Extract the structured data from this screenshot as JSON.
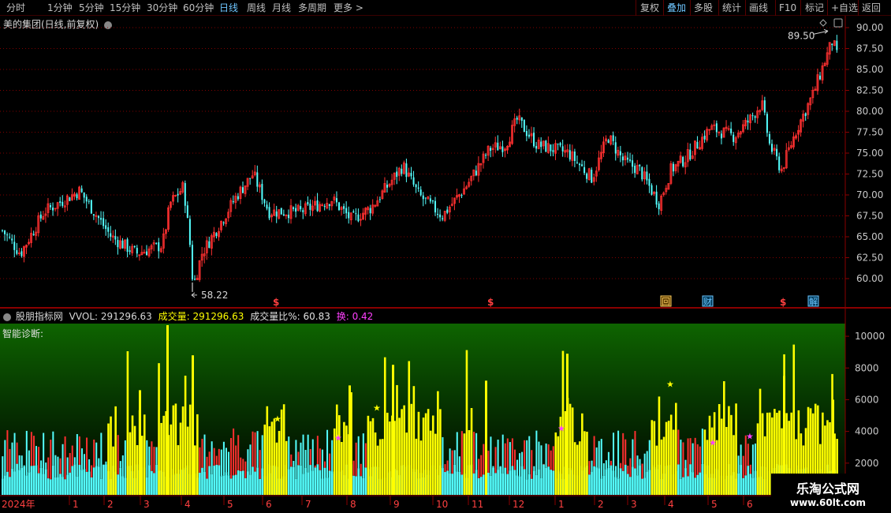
{
  "toolbar": {
    "left_items": [
      {
        "label": "分时",
        "active": false
      },
      {
        "label": "1分钟",
        "active": false
      },
      {
        "label": "5分钟",
        "active": false
      },
      {
        "label": "15分钟",
        "active": false
      },
      {
        "label": "30分钟",
        "active": false
      },
      {
        "label": "60分钟",
        "active": false
      },
      {
        "label": "日线",
        "active": true
      },
      {
        "label": "周线",
        "active": false
      },
      {
        "label": "月线",
        "active": false
      },
      {
        "label": "多周期",
        "active": false
      },
      {
        "label": "更多 >",
        "active": false
      }
    ],
    "right_items": [
      {
        "label": "复权",
        "active": false
      },
      {
        "label": "叠加",
        "active": true
      },
      {
        "label": "多股",
        "active": false
      },
      {
        "label": "统计",
        "active": false
      },
      {
        "label": "画线",
        "active": false
      },
      {
        "label": "F10",
        "active": false
      },
      {
        "label": "标记",
        "active": false
      },
      {
        "label": "+自选",
        "active": false
      },
      {
        "label": "返回",
        "active": false
      }
    ]
  },
  "main": {
    "stock_title": "美的集团(日线,前复权)",
    "price_axis": [
      "90.00",
      "87.50",
      "85.00",
      "82.50",
      "80.00",
      "77.50",
      "75.00",
      "72.50",
      "70.00",
      "67.50",
      "65.00",
      "62.50",
      "60.00"
    ],
    "high_label": "89.50",
    "low_label": "58.22",
    "markers": [
      {
        "label": "$",
        "color": "#ff4040"
      },
      {
        "label": "$",
        "color": "#ff4040"
      },
      {
        "label": "回",
        "color": "#ffd060"
      },
      {
        "label": "财",
        "color": "#6ec6ff"
      },
      {
        "label": "$",
        "color": "#ff4040"
      },
      {
        "label": "解",
        "color": "#6ec6ff"
      }
    ]
  },
  "indicator": {
    "name": "股朋指标网",
    "vol_label": "VVOL:",
    "vol_value": "291296.63",
    "cjl_label": "成交量:",
    "cjl_value": "291296.63",
    "ratio_label": "成交量比%:",
    "ratio_value": "60.83",
    "turnover_label": "换:",
    "turnover_value": "0.42",
    "diag_label": "智能诊断:",
    "axis": [
      "10000",
      "8000",
      "6000",
      "4000",
      "2000"
    ]
  },
  "timeline": {
    "year_label": "2024年",
    "months": [
      "1",
      "2",
      "3",
      "4",
      "5",
      "6",
      "7",
      "8",
      "9",
      "10",
      "11",
      "12",
      "1",
      "2",
      "3",
      "4",
      "5",
      "6"
    ]
  },
  "colors": {
    "up": "#ff3030",
    "down": "#54ffff",
    "yellow": "#ffff00",
    "grid": "#800000",
    "axis_text": "#c8c8c8",
    "green_bg": "#0c5a00"
  },
  "watermark": {
    "title": "乐淘公式网",
    "url": "www.60lt.com"
  }
}
